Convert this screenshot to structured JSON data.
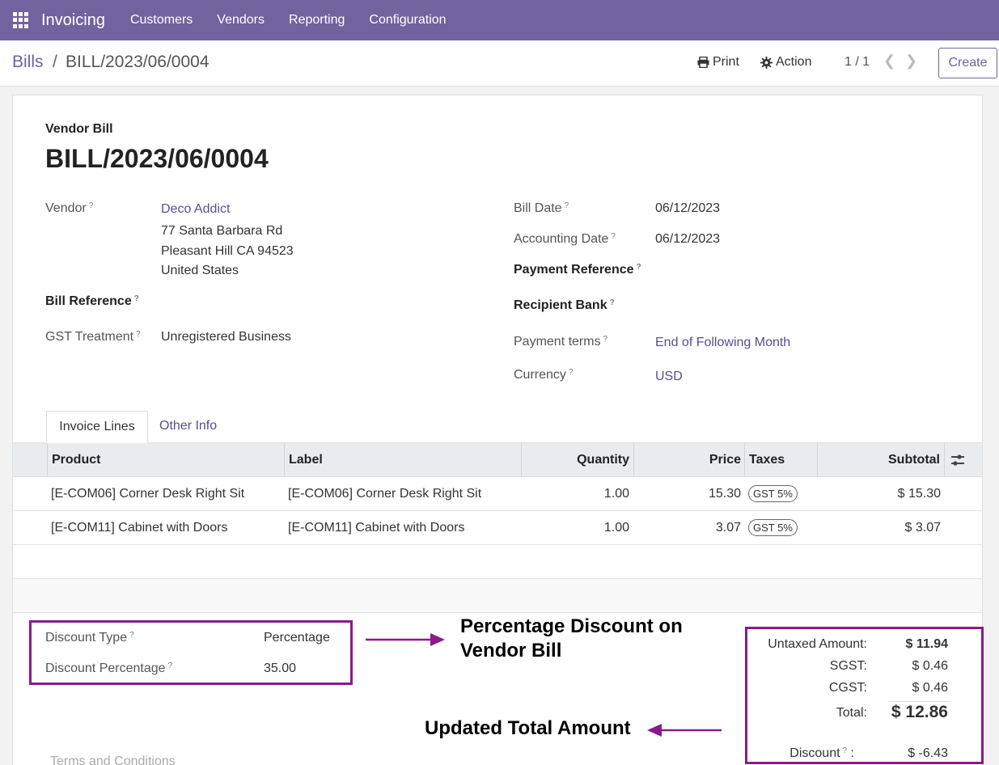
{
  "topbar": {
    "app_name": "Invoicing",
    "menu": [
      "Customers",
      "Vendors",
      "Reporting",
      "Configuration"
    ]
  },
  "control": {
    "breadcrumb_parent": "Bills",
    "breadcrumb_sep": "/",
    "breadcrumb_current": "BILL/2023/06/0004",
    "print_label": "Print",
    "action_label": "Action",
    "pager": "1 / 1",
    "create_label": "Create"
  },
  "form": {
    "doc_type": "Vendor Bill",
    "doc_name": "BILL/2023/06/0004",
    "vendor_label": "Vendor",
    "vendor_name": "Deco Addict",
    "vendor_addr1": "77 Santa Barbara Rd",
    "vendor_addr2": "Pleasant Hill CA 94523",
    "vendor_addr3": "United States",
    "bill_ref_label": "Bill Reference",
    "gst_label": "GST Treatment",
    "gst_value": "Unregistered Business",
    "bill_date_label": "Bill Date",
    "bill_date": "06/12/2023",
    "acc_date_label": "Accounting Date",
    "acc_date": "06/12/2023",
    "pay_ref_label": "Payment Reference",
    "recipient_bank_label": "Recipient Bank",
    "pay_terms_label": "Payment terms",
    "pay_terms": "End of Following Month",
    "currency_label": "Currency",
    "currency": "USD",
    "question_mark": "?"
  },
  "tabs": {
    "active": "Invoice Lines",
    "other": "Other Info"
  },
  "table": {
    "headers": {
      "product": "Product",
      "label": "Label",
      "quantity": "Quantity",
      "price": "Price",
      "taxes": "Taxes",
      "subtotal": "Subtotal"
    },
    "rows": [
      {
        "product": "[E-COM06] Corner Desk Right Sit",
        "label": "[E-COM06] Corner Desk Right Sit",
        "quantity": "1.00",
        "price": "15.30",
        "tax": "GST 5%",
        "subtotal": "$ 15.30"
      },
      {
        "product": "[E-COM11] Cabinet with Doors",
        "label": "[E-COM11] Cabinet with Doors",
        "quantity": "1.00",
        "price": "3.07",
        "tax": "GST 5%",
        "subtotal": "$ 3.07"
      }
    ]
  },
  "discount": {
    "type_label": "Discount Type",
    "type_value": "Percentage",
    "pct_label": "Discount Percentage",
    "pct_value": "35.00"
  },
  "annotations": {
    "discount_note_line1": "Percentage Discount on",
    "discount_note_line2": "Vendor Bill",
    "total_note": "Updated Total Amount"
  },
  "totals": {
    "untaxed_label": "Untaxed Amount:",
    "untaxed_value": "$ 11.94",
    "sgst_label": "SGST:",
    "sgst_value": "$ 0.46",
    "cgst_label": "CGST:",
    "cgst_value": "$ 0.46",
    "total_label": "Total:",
    "total_value": "$ 12.86",
    "discount_label": "Discount",
    "discount_colon": ":",
    "discount_value": "$ -6.43"
  },
  "terms_placeholder": "Terms and Conditions",
  "colors": {
    "brand": "#71639e",
    "link": "#5b4e8f",
    "annotation_border": "#8b1a8b"
  }
}
